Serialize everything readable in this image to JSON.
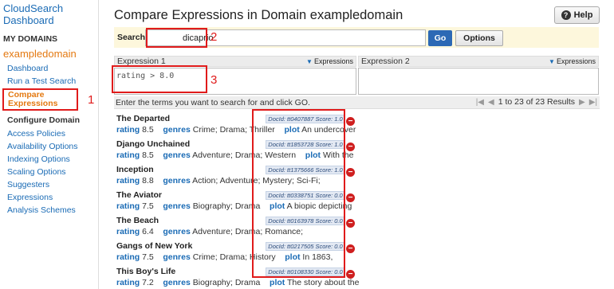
{
  "sidebar": {
    "brand": "CloudSearch Dashboard",
    "my_domains_heading": "MY DOMAINS",
    "domain_name": "exampledomain",
    "domain_links": [
      {
        "label": "Dashboard"
      },
      {
        "label": "Run a Test Search"
      }
    ],
    "active_item": "Compare Expressions",
    "configure_heading": "Configure Domain",
    "config_links": [
      {
        "label": "Access Policies"
      },
      {
        "label": "Availability Options"
      },
      {
        "label": "Indexing Options"
      },
      {
        "label": "Scaling Options"
      },
      {
        "label": "Suggesters"
      },
      {
        "label": "Expressions"
      },
      {
        "label": "Analysis Schemes"
      }
    ]
  },
  "header": {
    "title": "Compare Expressions in Domain exampledomain",
    "help_label": "Help"
  },
  "search": {
    "label": "Search:",
    "value": "dicaprio",
    "go_label": "Go",
    "options_label": "Options"
  },
  "expressions": {
    "panel1_label": "Expression 1",
    "panel2_label": "Expression 2",
    "toggle_label": "Expressions",
    "expr1_value": "rating > 8.0",
    "expr2_value": ""
  },
  "results": {
    "hint": "Enter the terms you want to search for and click GO.",
    "count_text": "1 to 23 of 23 Results",
    "field_names": {
      "rating": "rating",
      "genres": "genres",
      "plot": "plot"
    },
    "rows": [
      {
        "title": "The Departed",
        "rating": "8.5",
        "genres": "Crime; Drama; Thriller",
        "plot": "An undercover",
        "score_text": "DocId: tt0407887 Score: 1.0"
      },
      {
        "title": "Django Unchained",
        "rating": "8.5",
        "genres": "Adventure; Drama; Western",
        "plot": "With the",
        "score_text": "DocId: tt1853728 Score: 1.0"
      },
      {
        "title": "Inception",
        "rating": "8.8",
        "genres": "Action; Adventure; Mystery; Sci-Fi;",
        "plot": "",
        "score_text": "DocId: tt1375666 Score: 1.0"
      },
      {
        "title": "The Aviator",
        "rating": "7.5",
        "genres": "Biography; Drama",
        "plot": "A biopic depicting",
        "score_text": "DocId: tt0338751 Score: 0.0"
      },
      {
        "title": "The Beach",
        "rating": "6.4",
        "genres": "Adventure; Drama; Romance;",
        "plot": "",
        "score_text": "DocId: tt0163978 Score: 0.0"
      },
      {
        "title": "Gangs of New York",
        "rating": "7.5",
        "genres": "Crime; Drama; History",
        "plot": "In 1863,",
        "score_text": "DocId: tt0217505 Score: 0.0"
      },
      {
        "title": "This Boy's Life",
        "rating": "7.2",
        "genres": "Biography; Drama",
        "plot": "The story about the",
        "score_text": "DocId: tt0108330 Score: 0.0"
      }
    ]
  },
  "markers": {
    "m1": "1",
    "m2": "2",
    "m3": "3"
  },
  "colors": {
    "accent": "#1a6bb5",
    "active": "#e47911",
    "highlight": "#e01b1b",
    "go_button": "#2c69b5"
  }
}
